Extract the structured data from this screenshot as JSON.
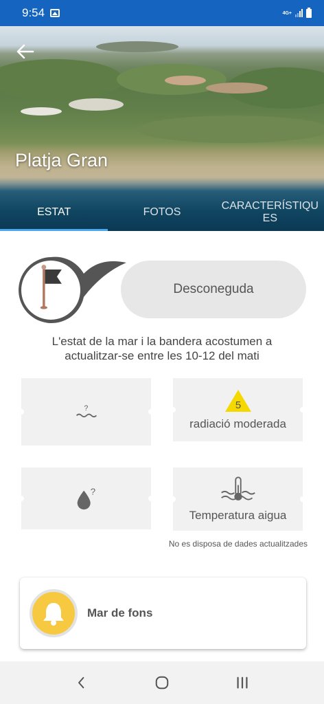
{
  "status_bar": {
    "time": "9:54",
    "network": "4G+"
  },
  "header": {
    "place_name": "Platja Gran",
    "tabs": [
      {
        "label": "ESTAT",
        "active": true
      },
      {
        "label": "FOTOS",
        "active": false
      },
      {
        "label": "CARACTERÍSTIQUES",
        "active": false
      }
    ]
  },
  "flag": {
    "status": "Desconeguda",
    "flag_color": "#3a3a3a"
  },
  "info_text": "L'estat de la mar i la bandera acostumen a actualitzar-se entre les 10-12 del mati",
  "cards": {
    "sea_state": {
      "icon": "unknown-waves-icon",
      "symbol": "?"
    },
    "uv": {
      "value": "5",
      "label": "radiació moderada",
      "color": "#f5d800"
    },
    "water_quality": {
      "icon": "water-drop-unknown-icon",
      "symbol": "?"
    },
    "water_temperature": {
      "icon": "thermometer-waves-icon",
      "label": "Temperatura aigua"
    }
  },
  "no_data_text": "No es disposa de dades actualitzades",
  "alert": {
    "title": "Mar de fons",
    "icon": "bell-icon",
    "color": "#f7c940"
  },
  "colors": {
    "status_bar": "#1565c0",
    "tab_indicator": "#4aa8ee",
    "card_bg": "#f1f1f1"
  }
}
